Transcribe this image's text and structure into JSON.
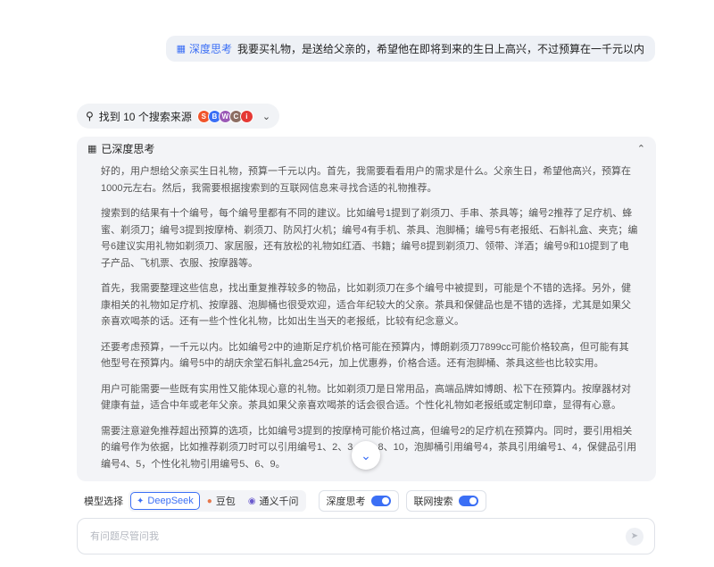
{
  "user_message": {
    "mode_icon": "deep-think-icon",
    "mode_label": "深度思考",
    "text": "我要买礼物，是送给父亲的，希望他在即将到来的生日上高兴，不过预算在一千元以内"
  },
  "sources": {
    "label": "找到 10 个搜索来源",
    "icons": [
      {
        "name": "source-icon-1",
        "color": "#f0552b",
        "glyph": "S"
      },
      {
        "name": "source-icon-2",
        "color": "#3b6ff5",
        "glyph": "B"
      },
      {
        "name": "source-icon-3",
        "color": "#9b59b6",
        "glyph": "W"
      },
      {
        "name": "source-icon-4",
        "color": "#8d6e63",
        "glyph": "C"
      },
      {
        "name": "source-icon-5",
        "color": "#e53935",
        "glyph": "i"
      }
    ]
  },
  "thinking": {
    "title": "已深度思考",
    "paragraphs": [
      "好的，用户想给父亲买生日礼物，预算一千元以内。首先，我需要看看用户的需求是什么。父亲生日，希望他高兴，预算在1000元左右。然后，我需要根据搜索到的互联网信息来寻找合适的礼物推荐。",
      "搜索到的结果有十个编号，每个编号里都有不同的建议。比如编号1提到了剃须刀、手串、茶具等；编号2推荐了足疗机、蜂蜜、剃须刀；编号3提到按摩椅、剃须刀、防风打火机；编号4有手机、茶具、泡脚桶；编号5有老报纸、石斛礼盒、夹克；编号6建议实用礼物如剃须刀、家居服，还有放松的礼物如红酒、书籍；编号8提到剃须刀、领带、洋酒；编号9和10提到了电子产品、飞机票、衣服、按摩器等。",
      "首先，我需要整理这些信息，找出重复推荐较多的物品，比如剃须刀在多个编号中被提到，可能是个不错的选择。另外，健康相关的礼物如足疗机、按摩器、泡脚桶也很受欢迎，适合年纪较大的父亲。茶具和保健品也是不错的选择，尤其是如果父亲喜欢喝茶的话。还有一些个性化礼物，比如出生当天的老报纸，比较有纪念意义。",
      "还要考虑预算，一千元以内。比如编号2中的迪斯足疗机价格可能在预算内，博朗剃须刀7899cc可能价格较高，但可能有其他型号在预算内。编号5中的胡庆余堂石斛礼盒254元，加上优惠券，价格合适。还有泡脚桶、茶具这些也比较实用。",
      "用户可能需要一些既有实用性又能体现心意的礼物。比如剃须刀是日常用品，高端品牌如博朗、松下在预算内。按摩器材对健康有益，适合中年或老年父亲。茶具如果父亲喜欢喝茶的话会很合适。个性化礼物如老报纸或定制印章，显得有心意。",
      "需要注意避免推荐超出预算的选项，比如编号3提到的按摩椅可能价格过高，但编号2的足疗机在预算内。同时，要引用相关的编号作为依据，比如推荐剃须刀时可以引用编号1、2、3、6、8、10，泡脚桶引用编号4，茶具引用编号1、4，保健品引用编号4、5，个性化礼物引用编号5、6、9。"
    ]
  },
  "toolbar": {
    "model_label": "模型选择",
    "models": [
      {
        "label": "DeepSeek",
        "icon": "deepseek-icon",
        "active": true
      },
      {
        "label": "豆包",
        "icon": "doubao-icon",
        "active": false
      },
      {
        "label": "通义千问",
        "icon": "qwen-icon",
        "active": false
      }
    ],
    "deep_think_label": "深度思考",
    "deep_think_on": true,
    "web_search_label": "联网搜索",
    "web_search_on": true
  },
  "input": {
    "placeholder": "有问题尽管问我"
  },
  "colors": {
    "accent": "#3b6ff5",
    "panel": "#f3f4f7"
  }
}
